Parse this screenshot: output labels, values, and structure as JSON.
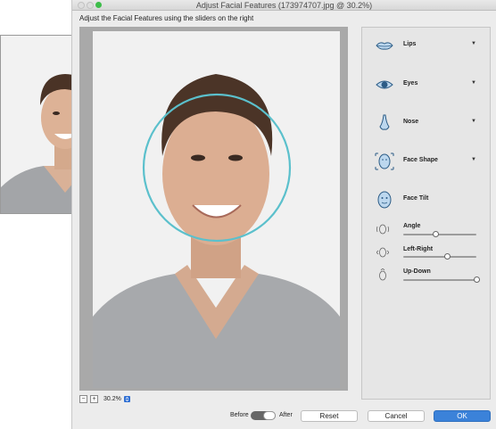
{
  "window": {
    "title": "Adjust Facial Features (173974707.jpg @ 30.2%)",
    "instruction": "Adjust the Facial Features using the sliders on the right"
  },
  "zoom": {
    "value": "30.2%"
  },
  "features": [
    {
      "label": "Lips",
      "icon": "lips-icon"
    },
    {
      "label": "Eyes",
      "icon": "eye-icon"
    },
    {
      "label": "Nose",
      "icon": "nose-icon"
    },
    {
      "label": "Face Shape",
      "icon": "face-shape-icon"
    },
    {
      "label": "Face Tilt",
      "icon": "face-tilt-icon"
    }
  ],
  "sliders": [
    {
      "label": "Angle",
      "value": 0.44,
      "icon": "angle-icon"
    },
    {
      "label": "Left-Right",
      "value": 0.6,
      "icon": "left-right-icon"
    },
    {
      "label": "Up-Down",
      "value": 1.0,
      "icon": "up-down-icon"
    }
  ],
  "toggle": {
    "before": "Before",
    "after": "After"
  },
  "buttons": {
    "reset": "Reset",
    "cancel": "Cancel",
    "ok": "OK"
  },
  "colors": {
    "accent": "#3b82d9",
    "selection_circle": "#5bc0cc"
  }
}
